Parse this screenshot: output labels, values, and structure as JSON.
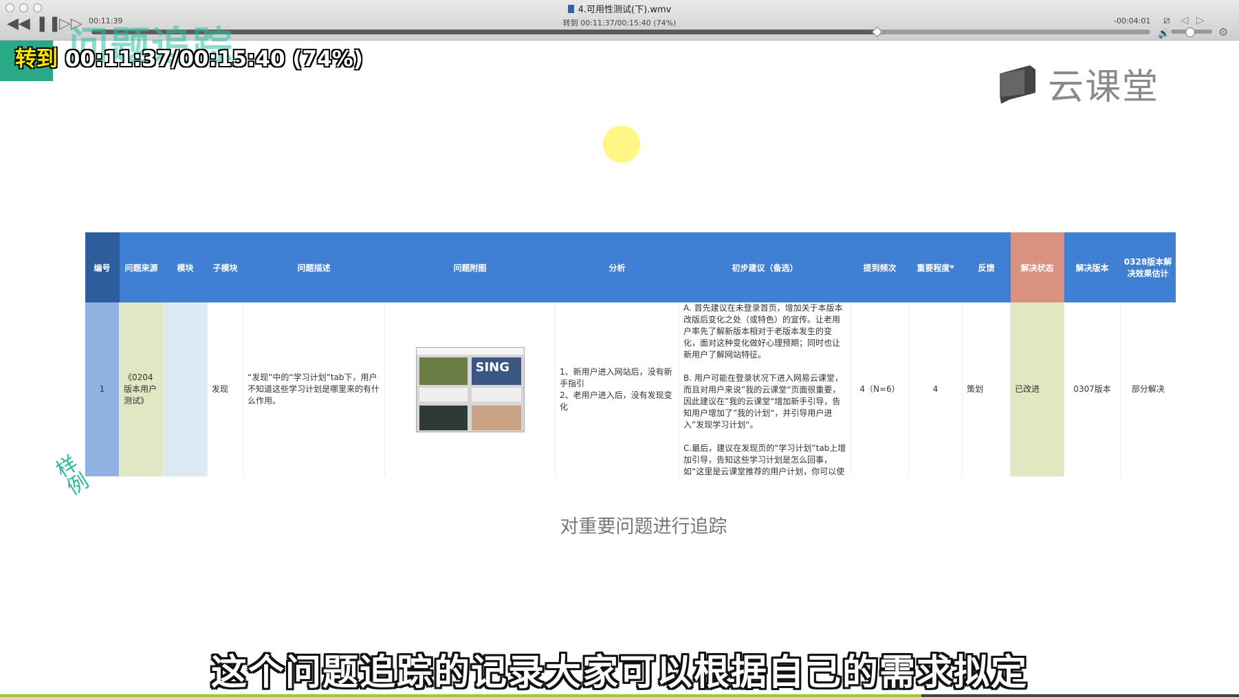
{
  "player": {
    "file_title": "4.可用性测试(下).wmv",
    "elapsed": "00:11:39",
    "seek_info": "转到 00:11:37/00:15:40 (74%)",
    "remaining": "-00:04:01",
    "progress_fraction": 0.74,
    "volume_fraction": 0.45,
    "controls": {
      "rewind_icon": "rewind-icon",
      "pause_icon": "pause-icon",
      "forward_icon": "fast-forward-icon",
      "prev_icon": "prev-icon",
      "next_icon": "next-icon",
      "speaker_icon": "speaker-icon",
      "settings_icon": "gear-icon"
    }
  },
  "overlay": {
    "goto_label": "转到",
    "goto_time": "00:11:37/00:15:40 (74%)"
  },
  "slide": {
    "bg_title": "问题追踪",
    "logo_text": "云课堂",
    "caption": "对重要问题进行追踪",
    "sample_stamp": "样例"
  },
  "table": {
    "headers": [
      "编号",
      "问题来源",
      "模块",
      "子模块",
      "问题描述",
      "问题附图",
      "分析",
      "初步建议（备选）",
      "提到频次",
      "重要程度*",
      "反馈",
      "解决状态",
      "解决版本",
      "0328版本解决效果估计"
    ],
    "row": {
      "id": "1",
      "source": "《0204版本用户测试》",
      "module": "",
      "submodule": "发现",
      "description": "“发现”中的“学习计划”tab下，用户不知道这些学习计划是哪里来的有什么作用。",
      "thumb_text": "SING",
      "analysis": "1、新用户进入网站后，没有新手指引\n2、老用户进入后，没有发现变化",
      "suggestions": [
        "A. 首先建议在未登录首页，增加关于本版本改版后变化之处（或特色）的宣传。让老用户率先了解新版本相对于老版本发生的变化，面对这种变化做好心理预期；同时也让新用户了解网站特征。",
        "B. 用户可能在登录状况下进入网易云课堂，而且对用户来说”我的云课堂“页面很重要，因此建议在”我的云课堂“增加新手引导，告知用户增加了”我的计划“，并引导用户进入”发现学习计划“。",
        "C.最后，建议在发现页的“学习计划”tab上增加引导，告知这些学习计划是怎么回事，如“这里是云课堂推荐的用户计划，你可以使用"
      ],
      "frequency": "4（N=6）",
      "importance": "4",
      "feedback": "策划",
      "status": "已改进",
      "version": "0307版本",
      "effect": "部分解决"
    }
  },
  "subtitle": "这个问题追踪的记录大家可以根据自己的需求拟定",
  "colors": {
    "header_blue": "#3f80d4",
    "header_dark": "#2e5d9d",
    "status_header": "#d9927f",
    "teal": "#2aa987"
  }
}
